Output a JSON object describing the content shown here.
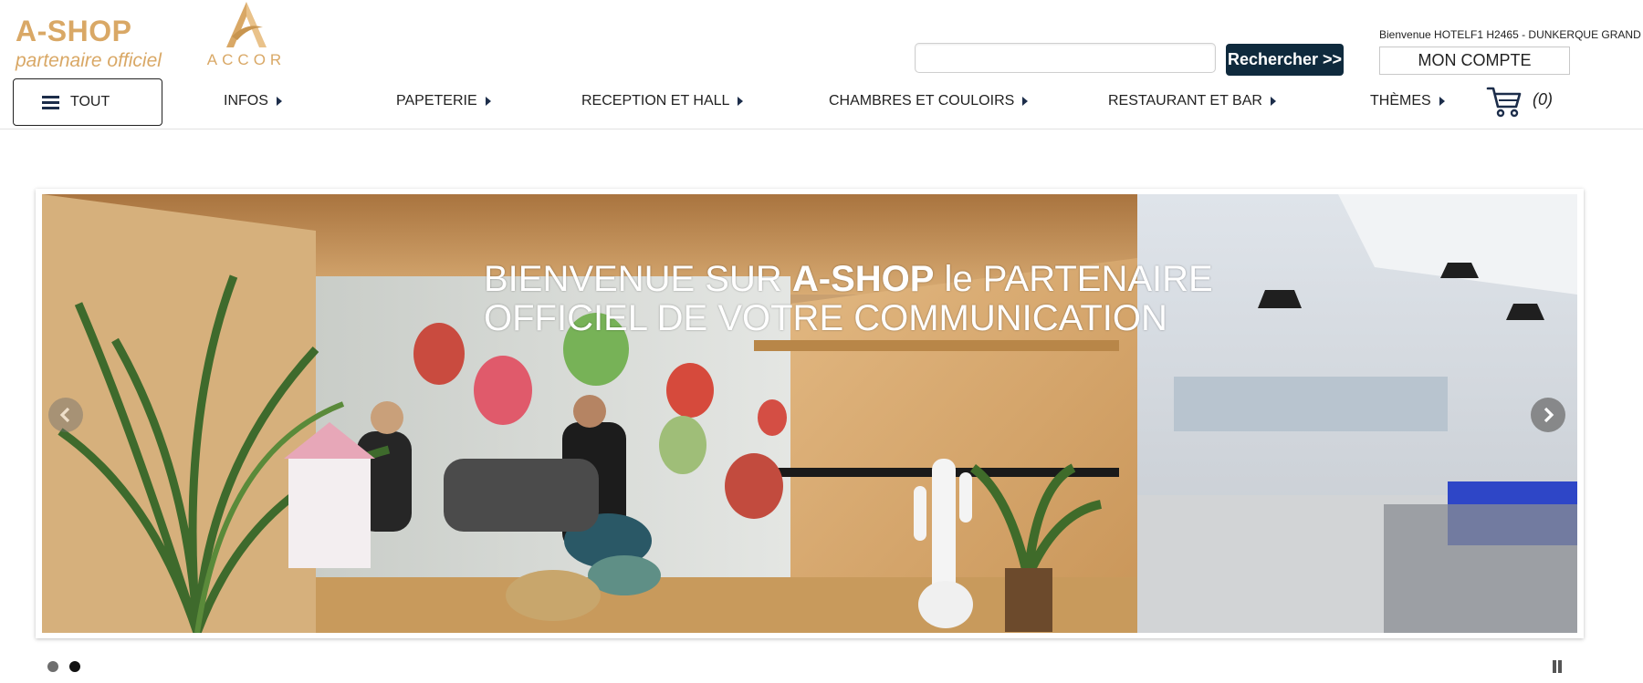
{
  "brand": {
    "name": "A-SHOP",
    "tagline": "partenaire officiel",
    "partner_logo_text": "ACCOR"
  },
  "search": {
    "value": "",
    "placeholder": "",
    "button_label": "Rechercher >>"
  },
  "user": {
    "welcome": "Bienvenue HOTELF1 H2465 - DUNKERQUE GRAND",
    "account_label": "MON COMPTE"
  },
  "nav": {
    "tout_label": "TOUT",
    "items": [
      {
        "label": "INFOS"
      },
      {
        "label": "PAPETERIE"
      },
      {
        "label": "RECEPTION ET HALL"
      },
      {
        "label": "CHAMBRES ET COULOIRS"
      },
      {
        "label": "RESTAURANT ET BAR"
      },
      {
        "label": "THÈMES"
      }
    ],
    "cart_count": "(0)"
  },
  "hero": {
    "line1_prefix": "BIENVENUE SUR ",
    "line1_bold": "A-SHOP",
    "line1_suffix": " le PARTENAIRE",
    "line2": "OFFICIEL DE VOTRE COMMUNICATION"
  },
  "slider": {
    "slide_count": 2,
    "active_index": 1
  },
  "colors": {
    "brand_gold": "#d9a866",
    "navy": "#0f2a3d",
    "nav_icon": "#1c2d4a"
  },
  "icons": [
    "hamburger-icon",
    "caret-right-icon",
    "cart-icon",
    "chevron-left-icon",
    "chevron-right-icon",
    "pause-icon"
  ]
}
